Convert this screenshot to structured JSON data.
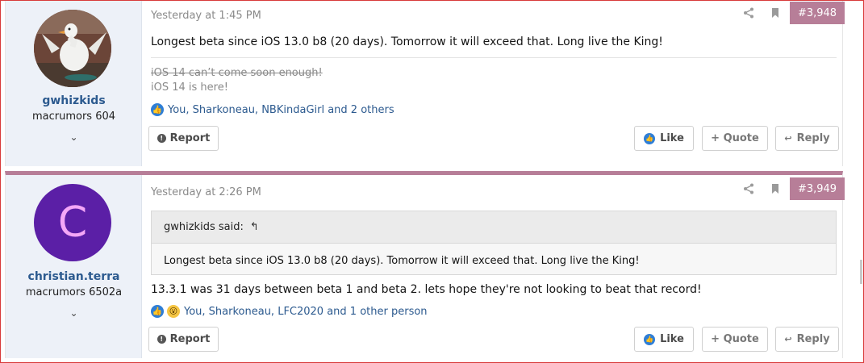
{
  "posts": [
    {
      "username": "gwhizkids",
      "user_title": "macrumors 604",
      "timestamp": "Yesterday at 1:45 PM",
      "post_number": "#3,948",
      "message": "Longest beta since iOS 13.0 b8 (20 days). Tomorrow it will exceed that. Long live the King!",
      "signature_struck": "iOS 14 can’t come soon enough!",
      "signature": "iOS 14 is here!",
      "reactions_text": "You, Sharkoneau, NBKindaGirl and 2 others",
      "report_label": "Report",
      "like_label": "Like",
      "quote_label": "+ Quote",
      "reply_label": "Reply"
    },
    {
      "username": "christian.terra",
      "user_title": "macrumors 6502a",
      "avatar_letter": "C",
      "timestamp": "Yesterday at 2:26 PM",
      "post_number": "#3,949",
      "quote_author": "gwhizkids said:",
      "quote_text": "Longest beta since iOS 13.0 b8 (20 days). Tomorrow it will exceed that. Long live the King!",
      "message": "13.3.1 was 31 days between beta 1 and beta 2. lets hope they're not looking to beat that record!",
      "reactions_text": "You, Sharkoneau, LFC2020 and 1 other person",
      "report_label": "Report",
      "like_label": "Like",
      "quote_label": "+ Quote",
      "reply_label": "Reply"
    }
  ],
  "colors": {
    "post_number_bg": "#b77e98",
    "username": "#2c5a8f",
    "user_col_bg": "#edf1f8",
    "like_blue": "#2e7ed6",
    "avatar_purple": "#5b1fa6",
    "avatar_letter": "#f4a7f7"
  },
  "icons": {
    "share": "share-icon",
    "bookmark": "bookmark-icon",
    "expand": "chevron-down-icon",
    "like": "thumbs-up-icon",
    "wow": "wow-face-icon",
    "report": "report-icon",
    "reply": "reply-arrow-icon",
    "quote_back": "quote-back-arrow-icon"
  }
}
